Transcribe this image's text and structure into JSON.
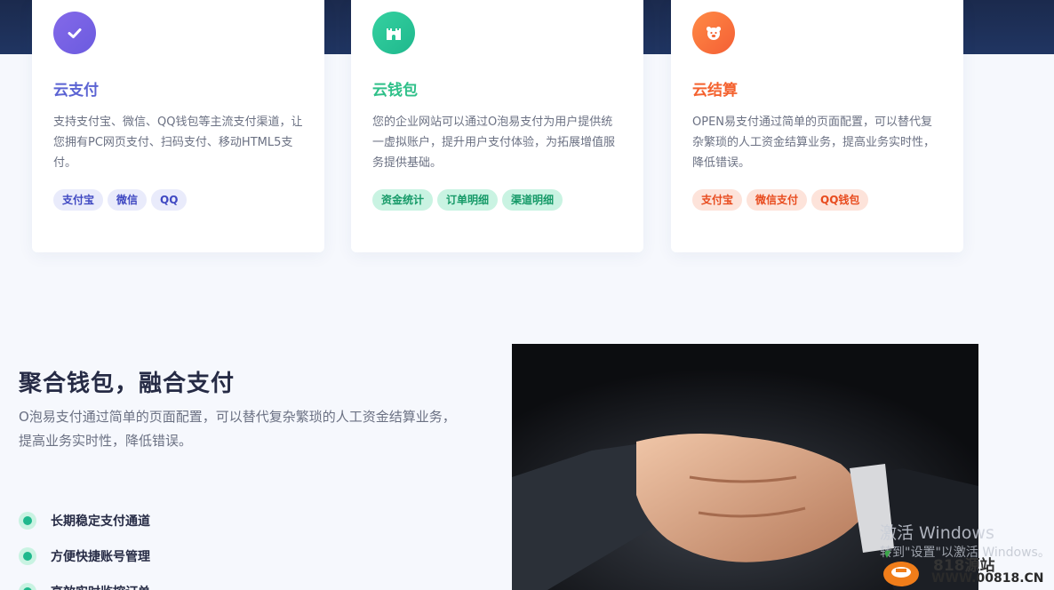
{
  "cards": [
    {
      "icon": "check-icon",
      "title": "云支付",
      "desc": "支持支付宝、微信、QQ钱包等主流支付渠道，让您拥有PC网页支付、扫码支付、移动HTML5支付。",
      "tags": [
        "支付宝",
        "微信",
        "QQ"
      ]
    },
    {
      "icon": "castle-icon",
      "title": "云钱包",
      "desc": "您的企业网站可以通过O泡易支付为用户提供统一虚拟账户，提升用户支付体验，为拓展增值服务提供基础。",
      "tags": [
        "资金统计",
        "订单明细",
        "渠道明细"
      ]
    },
    {
      "icon": "bear-icon",
      "title": "云结算",
      "desc": "OPEN易支付通过简单的页面配置，可以替代复杂繁琐的人工资金结算业务，提高业务实时性，降低错误。",
      "tags": [
        "支付宝",
        "微信支付",
        "QQ钱包"
      ]
    }
  ],
  "section": {
    "title": "聚合钱包，融合支付",
    "desc": "O泡易支付通过简单的页面配置，可以替代复杂繁琐的人工资金结算业务，提高业务实时性，降低错误。",
    "features": [
      "长期稳定支付通道",
      "方便快捷账号管理",
      "高效实时监控订单"
    ]
  },
  "image": {
    "subject": "handshake-photo"
  },
  "overlay": {
    "activate_title": "激活 Windows",
    "activate_sub": "转到\"设置\"以激活 Windows。",
    "site_name": "818源站",
    "site_url": "WWW.00818.CN"
  }
}
